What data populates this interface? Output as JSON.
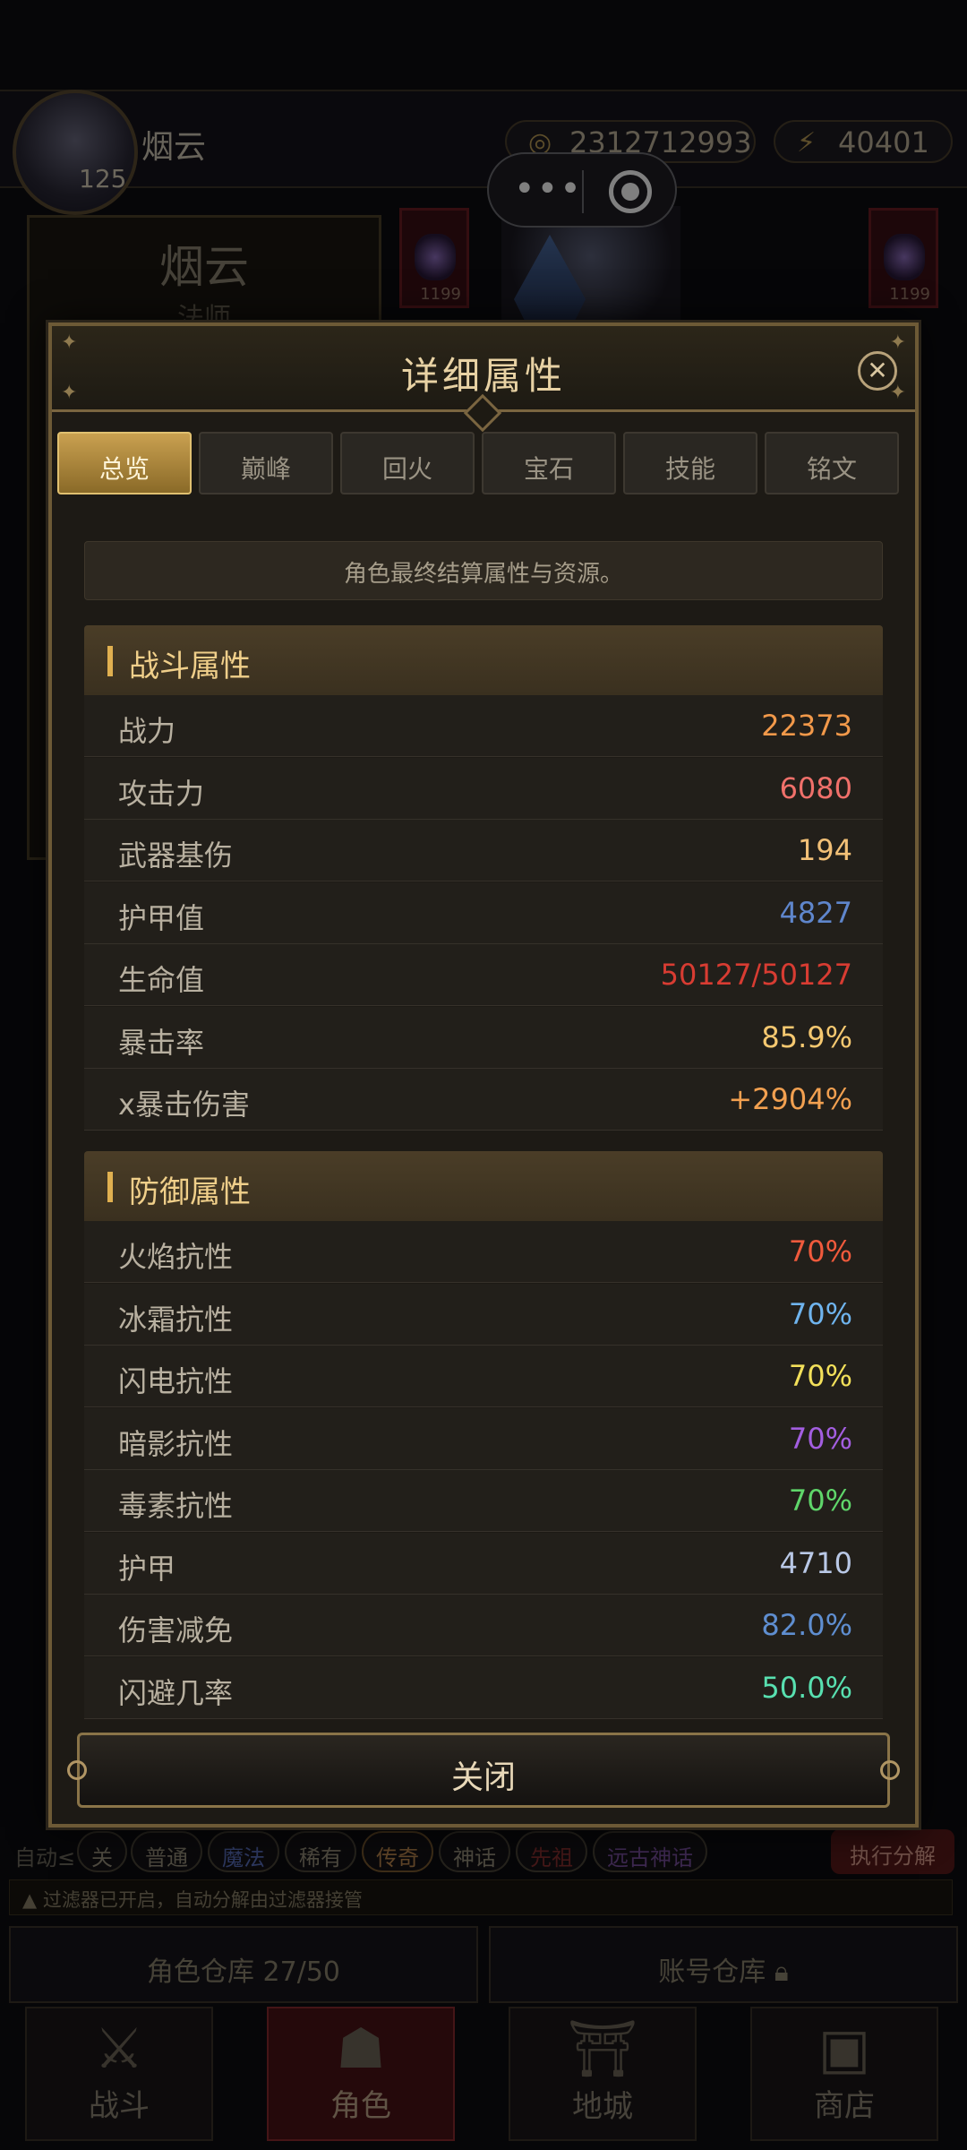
{
  "player": {
    "name": "烟云",
    "level": "125",
    "gold": "2312712993",
    "energy": "40401"
  },
  "character_panel": {
    "name": "烟云",
    "class": "法师",
    "slot_values": [
      "1199",
      "1199"
    ]
  },
  "modal": {
    "title": "详细属性",
    "tabs": [
      "总览",
      "巅峰",
      "回火",
      "宝石",
      "技能",
      "铭文"
    ],
    "active_tab": "总览",
    "note": "角色最终结算属性与资源。",
    "combat_section": {
      "title": "战斗属性",
      "rows": [
        {
          "label": "战力",
          "value": "22373",
          "color": "#f2994a"
        },
        {
          "label": "攻击力",
          "value": "6080",
          "color": "#f0706a"
        },
        {
          "label": "武器基伤",
          "value": "194",
          "color": "#f2c077"
        },
        {
          "label": "护甲值",
          "value": "4827",
          "color": "#5f86cc"
        },
        {
          "label": "生命值",
          "value": "50127/50127",
          "color": "#d83c32"
        },
        {
          "label": "暴击率",
          "value": "85.9%",
          "color": "#f5c870"
        },
        {
          "label": "x暴击伤害",
          "value": "+2904%",
          "color": "#f2a050"
        }
      ]
    },
    "defense_section": {
      "title": "防御属性",
      "rows": [
        {
          "label": "火焰抗性",
          "value": "70%",
          "color": "#f05a3c"
        },
        {
          "label": "冰霜抗性",
          "value": "70%",
          "color": "#6fb4ee"
        },
        {
          "label": "闪电抗性",
          "value": "70%",
          "color": "#f3e05a"
        },
        {
          "label": "暗影抗性",
          "value": "70%",
          "color": "#a35ee0"
        },
        {
          "label": "毒素抗性",
          "value": "70%",
          "color": "#5fd66a"
        },
        {
          "label": "护甲",
          "value": "4710",
          "color": "#b9c8e6"
        },
        {
          "label": "伤害减免",
          "value": "82.0%",
          "color": "#5f8ed0"
        },
        {
          "label": "闪避几率",
          "value": "50.0%",
          "color": "#58e0b0"
        }
      ]
    },
    "close_label": "关闭"
  },
  "filter_bar": {
    "auto_label": "自动≤",
    "chips": [
      "关",
      "普通",
      "魔法",
      "稀有",
      "传奇",
      "神话",
      "先祖",
      "远古神话"
    ],
    "execute_label": "执行分解",
    "notice": "过滤器已开启，自动分解由过滤器接管"
  },
  "storage": {
    "character": "角色仓库 27/50",
    "account": "账号仓库"
  },
  "bottom_nav": [
    {
      "label": "战斗",
      "icon": "crossed-swords"
    },
    {
      "label": "角色",
      "icon": "helmet"
    },
    {
      "label": "地城",
      "icon": "gate"
    },
    {
      "label": "商店",
      "icon": "chest"
    }
  ]
}
